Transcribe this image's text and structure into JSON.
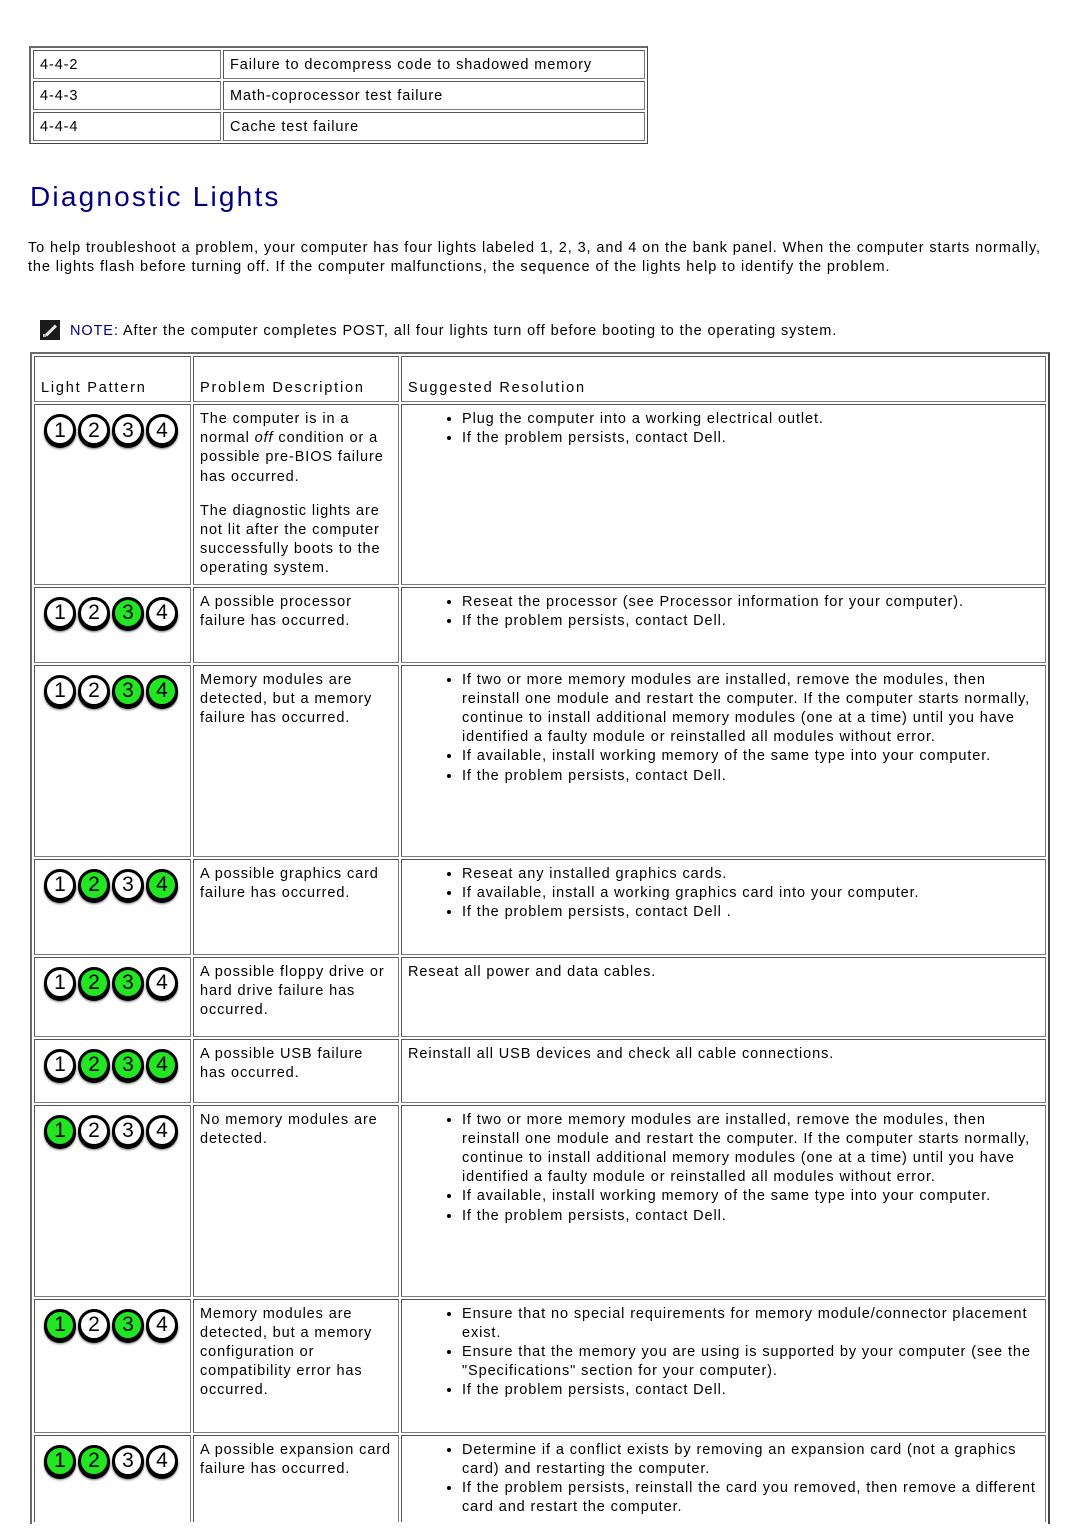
{
  "beep_codes": [
    {
      "code": "4-4-2",
      "cause": "Failure to decompress code to shadowed memory"
    },
    {
      "code": "4-4-3",
      "cause": "Math-coprocessor test failure"
    },
    {
      "code": "4-4-4",
      "cause": "Cache test failure"
    }
  ],
  "section": {
    "title": "Diagnostic Lights",
    "intro": "To help troubleshoot a problem, your computer has four lights labeled 1, 2, 3, and 4 on the bank panel. When the computer starts normally, the lights flash before turning off. If the computer malfunctions, the sequence of the lights help to identify the problem.",
    "note_icon": "pencil-note-icon",
    "note_label": "NOTE:",
    "note_text": " After the computer completes POST, all four lights turn off before booting to the operating system."
  },
  "colors": {
    "light_on": "#22e622",
    "title": "#000080"
  },
  "table": {
    "headers": {
      "pattern": "Light Pattern",
      "description": "Problem Description",
      "resolution": "Suggested Resolution"
    },
    "rows": [
      {
        "lights": [
          false,
          false,
          false,
          false
        ],
        "description_parts": [
          "The computer is in a normal ",
          "off",
          " condition or a possible pre-BIOS failure has occurred."
        ],
        "description_extra": "The diagnostic lights are not lit after the computer successfully boots to the operating system.",
        "resolution_list": [
          "Plug the computer into a working electrical outlet.",
          "If the problem persists, contact Dell."
        ]
      },
      {
        "lights": [
          false,
          false,
          true,
          false
        ],
        "description": "A possible processor failure has occurred.",
        "resolution_list": [
          "Reseat the processor (see Processor information for your computer).",
          "If the problem persists, contact Dell."
        ]
      },
      {
        "lights": [
          false,
          false,
          true,
          true
        ],
        "description": "Memory modules are detected, but a memory failure has occurred.",
        "resolution_list": [
          "If two or more memory modules are installed, remove the modules, then reinstall one module and restart the computer. If the computer starts normally, continue to install additional memory modules (one at a time) until you have identified a faulty module or reinstalled all modules without error.",
          "If available, install working memory of the same type into your computer.",
          "If the problem persists, contact Dell."
        ]
      },
      {
        "lights": [
          false,
          true,
          false,
          true
        ],
        "description": "A possible graphics card failure has occurred.",
        "resolution_list": [
          "Reseat any installed graphics cards.",
          "If available, install a working graphics card into your computer.",
          "If the problem persists, contact Dell ."
        ]
      },
      {
        "lights": [
          false,
          true,
          true,
          false
        ],
        "description": "A possible floppy drive or hard drive failure has occurred.",
        "resolution_text": "Reseat all power and data cables."
      },
      {
        "lights": [
          false,
          true,
          true,
          true
        ],
        "description": "A possible USB failure has occurred.",
        "resolution_text": "Reinstall all USB devices and check all cable connections."
      },
      {
        "lights": [
          true,
          false,
          false,
          false
        ],
        "description": "No memory modules are detected.",
        "resolution_list": [
          "If two or more memory modules are installed, remove the modules, then reinstall one module and restart the computer. If the computer starts normally, continue to install additional memory modules (one at a time) until you have identified a faulty module or reinstalled all modules without error.",
          "If available, install working memory of the same type into your computer.",
          "If the problem persists, contact Dell."
        ]
      },
      {
        "lights": [
          true,
          false,
          true,
          false
        ],
        "description": "Memory modules are detected, but a memory configuration or compatibility error has occurred.",
        "resolution_list": [
          "Ensure that no special requirements for memory module/connector placement exist.",
          "Ensure that the memory you are using is supported by your computer (see the \"Specifications\" section for your computer).",
          "If the problem persists, contact Dell."
        ]
      },
      {
        "lights": [
          true,
          true,
          false,
          false
        ],
        "description": "A possible expansion card failure has occurred.",
        "resolution_list": [
          "Determine if a conflict exists by removing an expansion card (not a graphics card) and restarting the computer.",
          "If the problem persists, reinstall the card you removed, then remove a different card and restart the computer."
        ]
      }
    ]
  }
}
